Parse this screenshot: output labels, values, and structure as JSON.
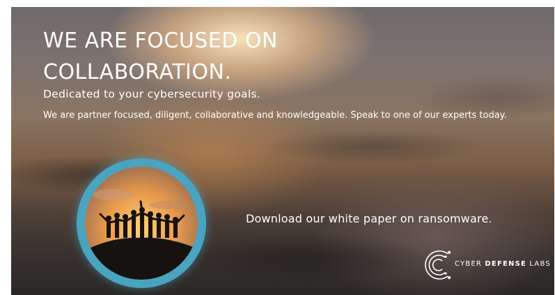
{
  "headline": "WE ARE FOCUSED ON COLLABORATION.",
  "subheadline": "Dedicated to your cybersecurity goals.",
  "body_text": "We are partner focused, diligent, collaborative and knowledgeable. Speak to one of our experts today.",
  "cta_text": "Download our white paper on ransomware.",
  "logo": {
    "part1": "CYBER ",
    "part2": "DEFENSE",
    "part3": " LABS",
    "icon": "cdl-c-circuit-logo"
  },
  "colors": {
    "ring": "#4aa3bf",
    "text": "#ffffff"
  }
}
